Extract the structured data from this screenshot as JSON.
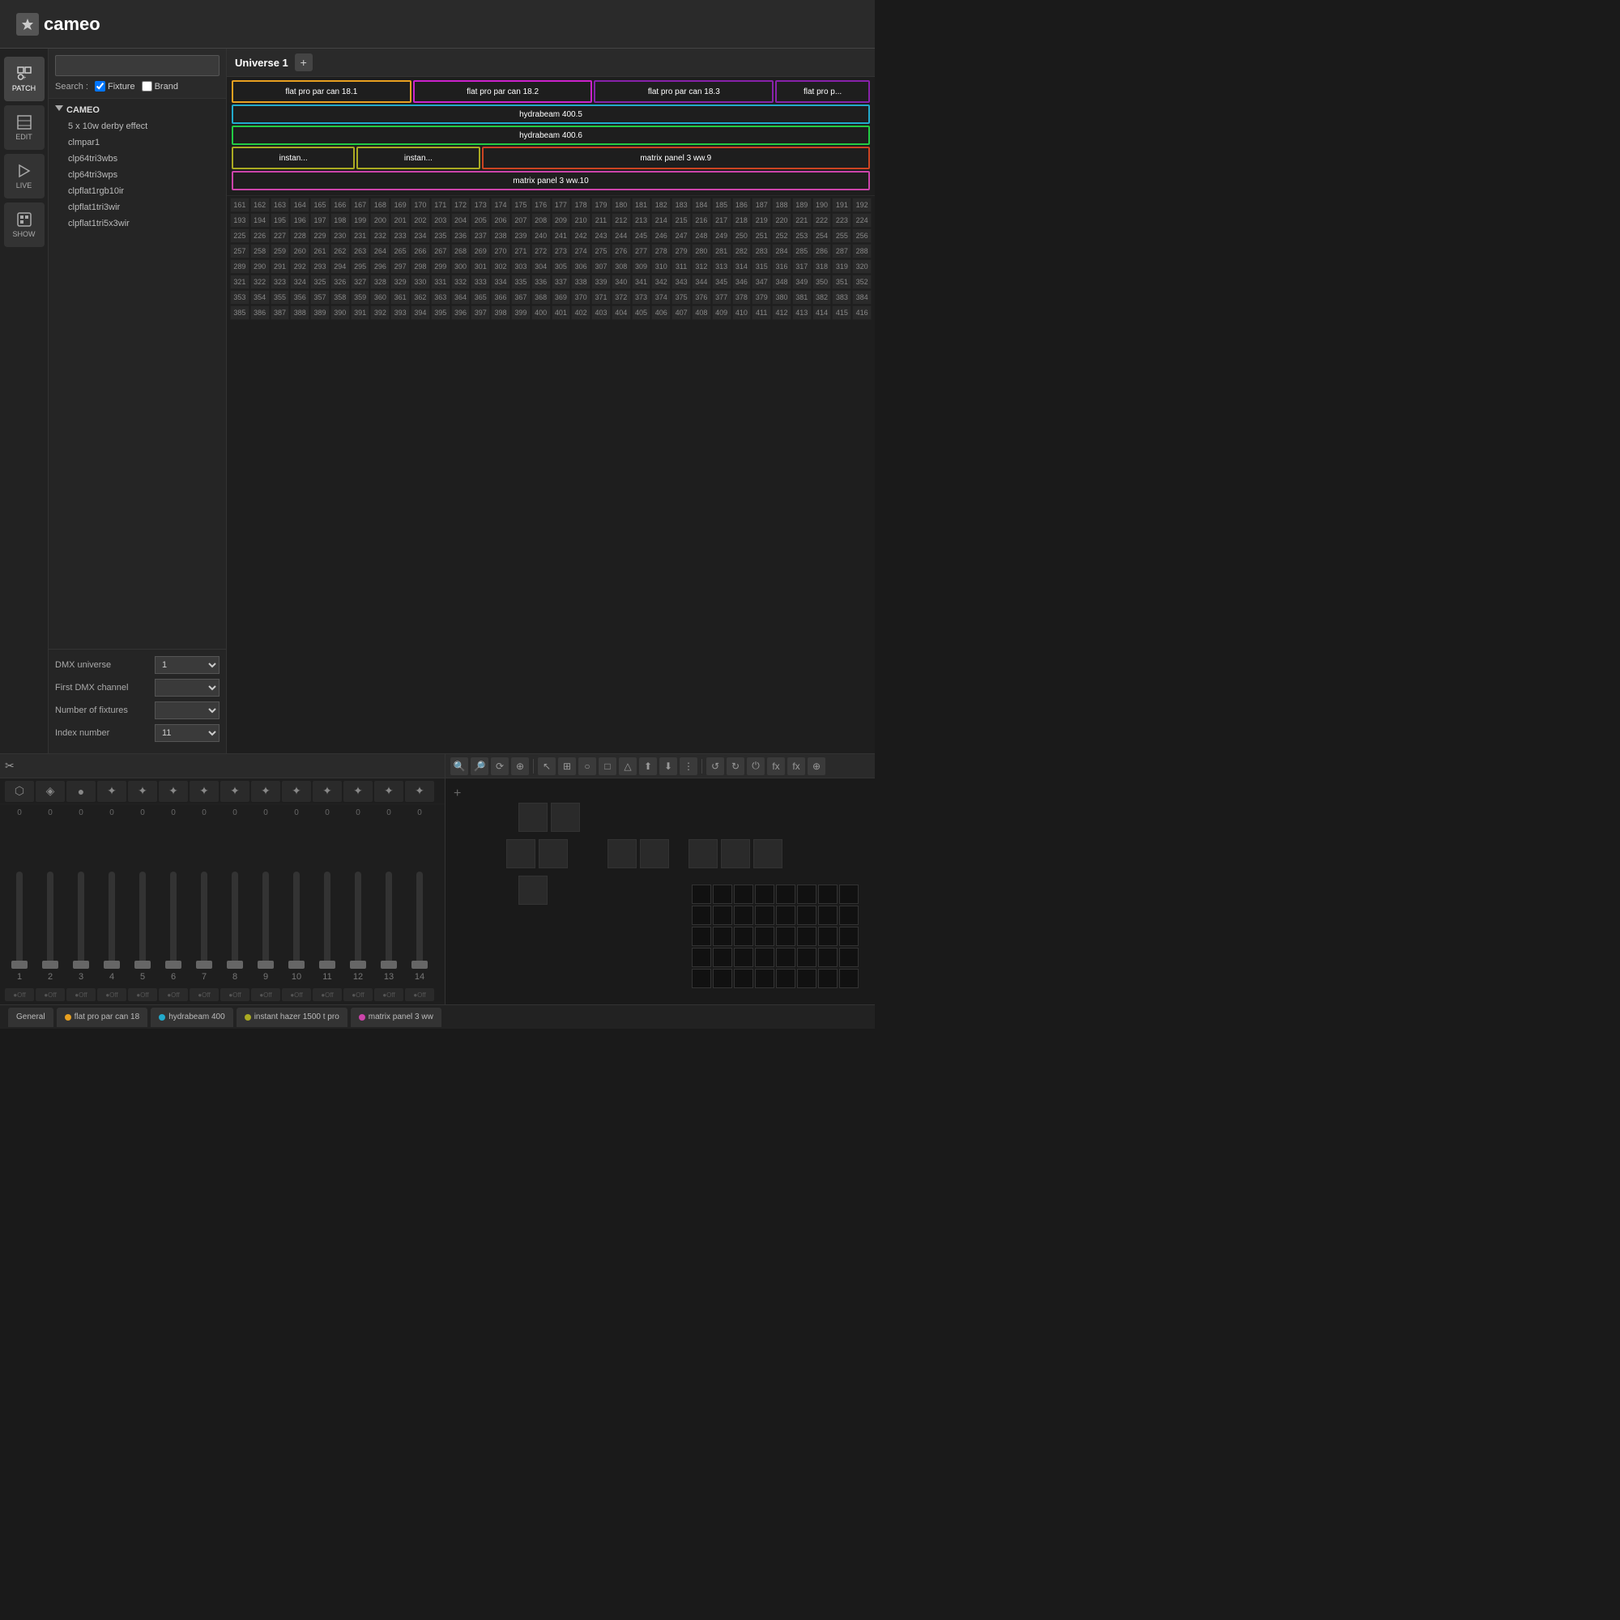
{
  "app": {
    "title": "cameo",
    "logo_symbol": "✦"
  },
  "sidebar": {
    "buttons": [
      {
        "id": "patch",
        "label": "PATCH",
        "icon": "⊞",
        "active": true
      },
      {
        "id": "edit",
        "label": "EDIT",
        "icon": "✎",
        "active": false
      },
      {
        "id": "live",
        "label": "LIVE",
        "icon": "▶",
        "active": false
      },
      {
        "id": "show",
        "label": "SHOW",
        "icon": "⊡",
        "active": false
      }
    ]
  },
  "search": {
    "placeholder": "",
    "label": "Search :",
    "fixture_label": "Fixture",
    "brand_label": "Brand"
  },
  "tree": {
    "brand": "CAMEO",
    "items": [
      "5 x 10w derby effect",
      "clmpar1",
      "clp64tri3wbs",
      "clp64tri3wps",
      "clpflat1rgb10ir",
      "clpflat1tri3wir",
      "clpflat1tri5x3wir"
    ]
  },
  "patch_fields": {
    "dmx_universe_label": "DMX universe",
    "dmx_universe_value": "1",
    "first_dmx_label": "First DMX channel",
    "first_dmx_value": "",
    "num_fixtures_label": "Number of fixtures",
    "num_fixtures_value": "",
    "index_label": "Index number",
    "index_value": "11"
  },
  "universe": {
    "title": "Universe 1",
    "add_button": "+"
  },
  "fixtures": [
    {
      "label": "flat pro par can 18.1",
      "color": "#e8a020",
      "border": "#e8a020",
      "width": "flex"
    },
    {
      "label": "flat pro par can 18.2",
      "color": "#cc22cc",
      "border": "#cc22cc",
      "width": "flex"
    },
    {
      "label": "flat pro par can 18.3",
      "color": "#8822aa",
      "border": "#8822aa",
      "width": "flex"
    },
    {
      "label": "flat pro p...",
      "color": "#8822aa",
      "border": "#8822aa",
      "width": "flex"
    }
  ],
  "full_bars": [
    {
      "label": "hydrabeam 400.5",
      "color": "#22aacc",
      "border": "#22aacc"
    },
    {
      "label": "hydrabeam 400.6",
      "color": "#22cc44",
      "border": "#22cc44"
    },
    {
      "label": "matrix panel 3 ww.9",
      "color": "#cc4422",
      "border": "#cc4422"
    },
    {
      "label": "matrix panel 3 ww.10",
      "color": "#cc44aa",
      "border": "#cc44aa"
    }
  ],
  "instant_bars": [
    {
      "label": "instan...",
      "color": "#aaaa22"
    },
    {
      "label": "instan...",
      "color": "#aaaa22"
    }
  ],
  "dmx_grid": {
    "start": 161,
    "rows": 8,
    "cols": 32
  },
  "faders": {
    "toolbar_icon": "✂",
    "icons": [
      "⬡",
      "◈",
      "●",
      "❊",
      "✦",
      "✦",
      "✦",
      "✦",
      "✦",
      "✦",
      "✦",
      "✦",
      "✦",
      "✦"
    ],
    "numbers": [
      "0",
      "0",
      "0",
      "0",
      "0",
      "0",
      "0",
      "0",
      "0",
      "0",
      "0",
      "0",
      "0",
      "0"
    ],
    "labels": [
      "1",
      "2",
      "3",
      "4",
      "5",
      "6",
      "7",
      "8",
      "9",
      "10",
      "11",
      "12",
      "13",
      "14"
    ],
    "btn_labels": [
      "●Off",
      "●Off",
      "●Off",
      "●Off",
      "●Off",
      "●Off",
      "●Off",
      "●Off",
      "●Off",
      "●Off",
      "●Off",
      "●Off",
      "●Off",
      "●Off"
    ]
  },
  "viz_toolbar": {
    "tools": [
      "🔍",
      "🔍",
      "⟳",
      "⊕",
      "⊞",
      "☩",
      "⊡",
      "⊠",
      "⊟",
      "⊞",
      "↑",
      "↓",
      "⋮",
      "↺",
      "↻",
      "⏻",
      "⊕",
      "⊟",
      "☩"
    ]
  },
  "bottom_tabs": [
    {
      "label": "General",
      "color": "",
      "active": false
    },
    {
      "label": "flat pro par can 18",
      "color": "#e8a020",
      "active": false
    },
    {
      "label": "hydrabeam 400",
      "color": "#22aacc",
      "active": false
    },
    {
      "label": "instant hazer 1500 t pro",
      "color": "#aaaa22",
      "active": false
    },
    {
      "label": "matrix panel 3 ww",
      "color": "#cc44aa",
      "active": false
    }
  ]
}
